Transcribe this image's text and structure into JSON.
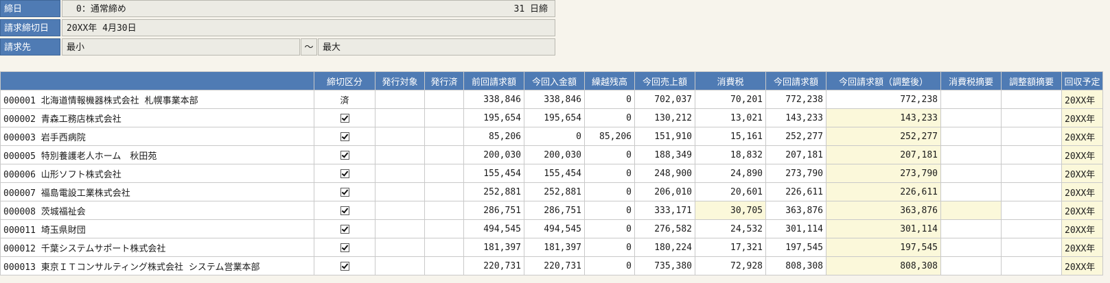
{
  "filters": {
    "closing_day": {
      "label": "締日",
      "value": "0：通常締め",
      "day": "31 日締"
    },
    "billing_cutoff": {
      "label": "請求締切日",
      "value": "20XX年 4月30日"
    },
    "billing_to": {
      "label": "請求先",
      "from": "最小",
      "tilde": "～",
      "to": "最大"
    }
  },
  "table": {
    "headers": [
      "",
      "締切区分",
      "発行対象",
      "発行済",
      "前回請求額",
      "今回入金額",
      "繰越残高",
      "今回売上額",
      "消費税",
      "今回請求額",
      "今回請求額（調整後）",
      "消費税摘要",
      "調整額摘要",
      "回収予定"
    ],
    "rows": [
      {
        "customer": "000001 北海道情報機器株式会社 札幌事業本部",
        "status": "済",
        "checked": false,
        "prev": "338,846",
        "paid": "338,846",
        "carry": "0",
        "sales": "702,037",
        "tax": "70,201",
        "billing": "772,238",
        "adjusted": "772,238",
        "date": "20XX年",
        "hl_adj": false,
        "hl_tax": false
      },
      {
        "customer": "000002 青森工務店株式会社",
        "status": "",
        "checked": true,
        "prev": "195,654",
        "paid": "195,654",
        "carry": "0",
        "sales": "130,212",
        "tax": "13,021",
        "billing": "143,233",
        "adjusted": "143,233",
        "date": "20XX年",
        "hl_adj": true,
        "hl_tax": false
      },
      {
        "customer": "000003 岩手西病院",
        "status": "",
        "checked": true,
        "prev": "85,206",
        "paid": "0",
        "carry": "85,206",
        "sales": "151,910",
        "tax": "15,161",
        "billing": "252,277",
        "adjusted": "252,277",
        "date": "20XX年",
        "hl_adj": true,
        "hl_tax": false
      },
      {
        "customer": "000005 特別養護老人ホーム　秋田苑",
        "status": "",
        "checked": true,
        "prev": "200,030",
        "paid": "200,030",
        "carry": "0",
        "sales": "188,349",
        "tax": "18,832",
        "billing": "207,181",
        "adjusted": "207,181",
        "date": "20XX年",
        "hl_adj": true,
        "hl_tax": false
      },
      {
        "customer": "000006 山形ソフト株式会社",
        "status": "",
        "checked": true,
        "prev": "155,454",
        "paid": "155,454",
        "carry": "0",
        "sales": "248,900",
        "tax": "24,890",
        "billing": "273,790",
        "adjusted": "273,790",
        "date": "20XX年",
        "hl_adj": true,
        "hl_tax": false
      },
      {
        "customer": "000007 福島電設工業株式会社",
        "status": "",
        "checked": true,
        "prev": "252,881",
        "paid": "252,881",
        "carry": "0",
        "sales": "206,010",
        "tax": "20,601",
        "billing": "226,611",
        "adjusted": "226,611",
        "date": "20XX年",
        "hl_adj": true,
        "hl_tax": false
      },
      {
        "customer": "000008 茨城福祉会",
        "status": "",
        "checked": true,
        "prev": "286,751",
        "paid": "286,751",
        "carry": "0",
        "sales": "333,171",
        "tax": "30,705",
        "billing": "363,876",
        "adjusted": "363,876",
        "date": "20XX年",
        "hl_adj": true,
        "hl_tax": true
      },
      {
        "customer": "000011 埼玉県財団",
        "status": "",
        "checked": true,
        "prev": "494,545",
        "paid": "494,545",
        "carry": "0",
        "sales": "276,582",
        "tax": "24,532",
        "billing": "301,114",
        "adjusted": "301,114",
        "date": "20XX年",
        "hl_adj": true,
        "hl_tax": false
      },
      {
        "customer": "000012 千葉システムサポート株式会社",
        "status": "",
        "checked": true,
        "prev": "181,397",
        "paid": "181,397",
        "carry": "0",
        "sales": "180,224",
        "tax": "17,321",
        "billing": "197,545",
        "adjusted": "197,545",
        "date": "20XX年",
        "hl_adj": true,
        "hl_tax": false
      },
      {
        "customer": "000013 東京ＩＴコンサルティング株式会社 システム営業本部",
        "status": "",
        "checked": true,
        "prev": "220,731",
        "paid": "220,731",
        "carry": "0",
        "sales": "735,380",
        "tax": "72,928",
        "billing": "808,308",
        "adjusted": "808,308",
        "date": "20XX年",
        "hl_adj": true,
        "hl_tax": false
      }
    ]
  }
}
